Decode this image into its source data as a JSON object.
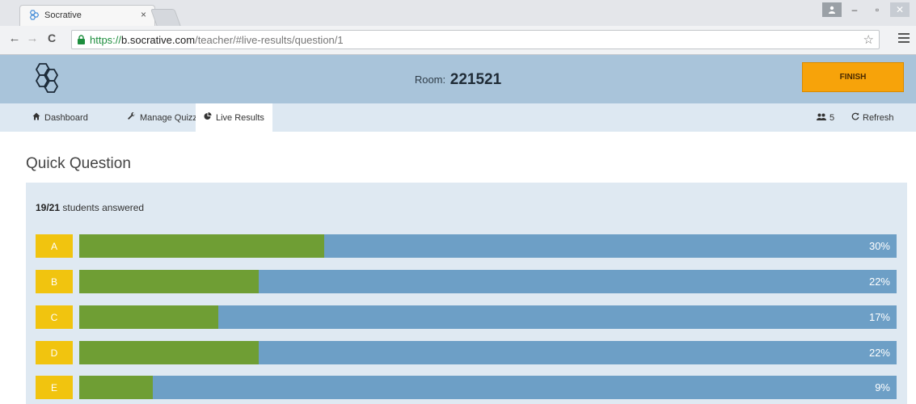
{
  "browser": {
    "tab_title": "Socrative",
    "tab_close": "×",
    "url_scheme": "https://",
    "url_host": "b.socrative.com",
    "url_path": "/teacher/#live-results/question/1",
    "back_icon": "←",
    "forward_icon": "→",
    "reload_icon": "C",
    "star_icon": "☆",
    "minimize_icon": "–",
    "maximize_icon": "▫",
    "close_icon": "✕"
  },
  "header": {
    "room_label": "Room:",
    "room_code": "221521",
    "finish_label": "FINISH"
  },
  "nav": {
    "items": [
      {
        "label": "Dashboard",
        "icon": "home-icon"
      },
      {
        "label": "Manage Quizzes",
        "icon": "wrench-icon"
      },
      {
        "label": "Live Results",
        "icon": "pie-chart-icon"
      }
    ],
    "student_count": "5",
    "refresh_label": "Refresh"
  },
  "main": {
    "title": "Quick Question",
    "answered_count": "19/21",
    "answered_text": "students answered",
    "answers": [
      {
        "letter": "A",
        "percent": 30,
        "label": "30%"
      },
      {
        "letter": "B",
        "percent": 22,
        "label": "22%"
      },
      {
        "letter": "C",
        "percent": 17,
        "label": "17%"
      },
      {
        "letter": "D",
        "percent": 22,
        "label": "22%"
      },
      {
        "letter": "E",
        "percent": 9,
        "label": "9%"
      }
    ]
  },
  "colors": {
    "header_bg": "#a9c4da",
    "nav_bg": "#dde8f2",
    "finish": "#f7a30a",
    "letter_box": "#f1c40f",
    "bar_fill": "#6f9e34",
    "bar_track": "#6d9fc6"
  }
}
